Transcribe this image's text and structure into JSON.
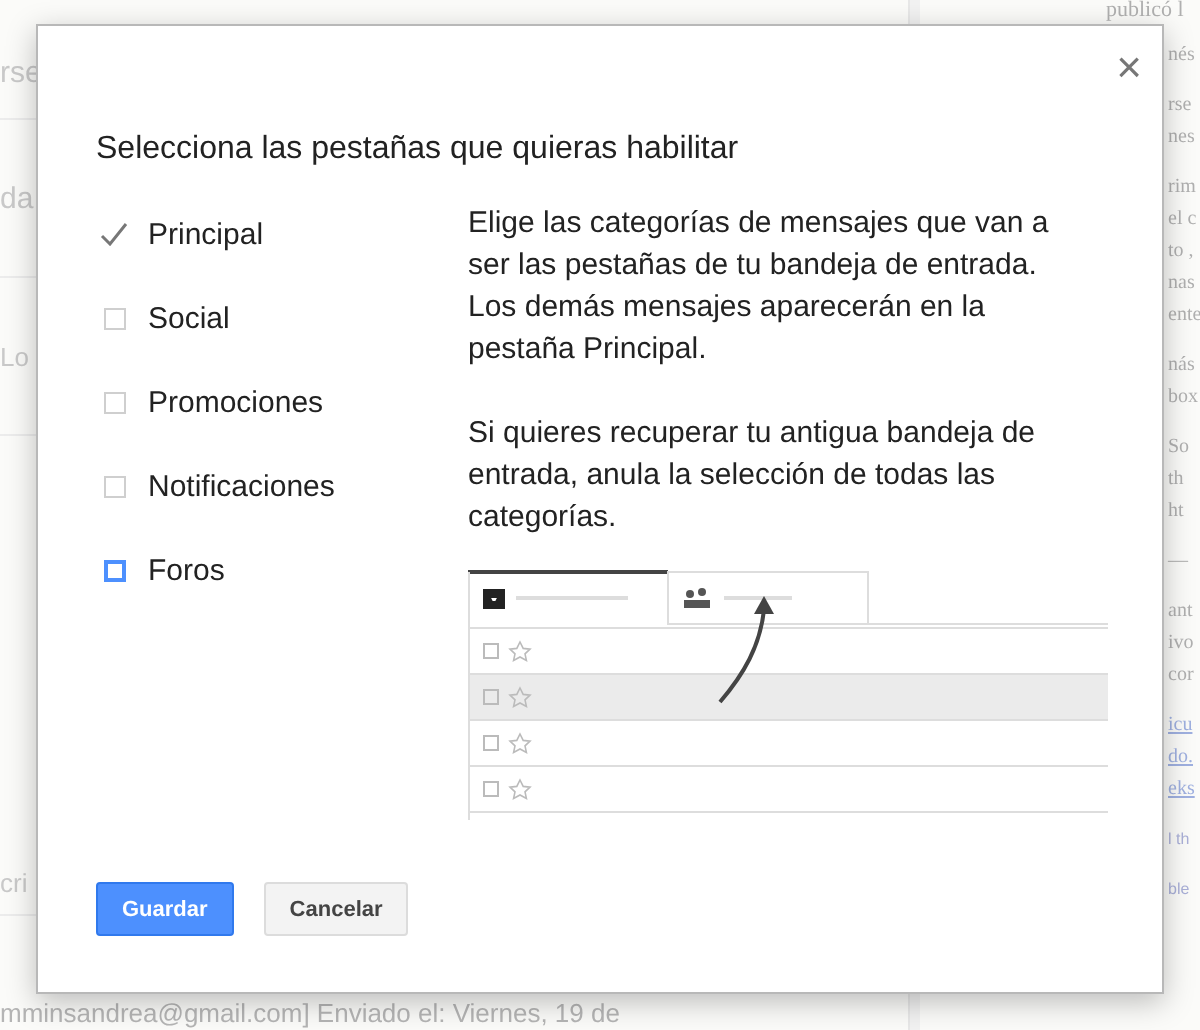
{
  "background": {
    "left_fragments": [
      "rse",
      "da",
      "Lo",
      "cri"
    ],
    "right_paragraphs": [
      {
        "lines": [
          "publicó l"
        ],
        "kind": "top"
      },
      {
        "lines": [
          "nés"
        ]
      },
      {
        "lines": [
          "rse",
          "nes"
        ]
      },
      {
        "lines": [
          "rim",
          "el c",
          "to ,",
          "nas",
          "ente"
        ]
      },
      {
        "lines": [
          "nás",
          "box"
        ]
      },
      {
        "lines": [
          "So",
          "th",
          "ht"
        ],
        "kind": "quote"
      },
      {
        "lines": [
          "—"
        ]
      },
      {
        "lines": [
          "ant",
          "ivo",
          "cor"
        ]
      },
      {
        "lines": [
          "icu",
          "do.",
          "eks"
        ],
        "kind": "links"
      },
      {
        "lines": [
          "l th"
        ],
        "kind": "small"
      },
      {
        "lines": [
          "ble"
        ],
        "kind": "small"
      }
    ],
    "bottom_line": "mminsandrea@gmail.com] Enviado el: Viernes, 19 de"
  },
  "dialog": {
    "title": "Selecciona las pestañas que quieras habilitar",
    "close": "×",
    "categories": [
      {
        "label": "Principal",
        "checked": true,
        "focused": false
      },
      {
        "label": "Social",
        "checked": false,
        "focused": false
      },
      {
        "label": "Promociones",
        "checked": false,
        "focused": false
      },
      {
        "label": "Notificaciones",
        "checked": false,
        "focused": false
      },
      {
        "label": "Foros",
        "checked": false,
        "focused": true
      }
    ],
    "paragraphs": [
      "Elige las categorías de mensajes que van a ser las pestañas de tu bandeja de entrada. Los demás mensajes aparecerán en la pestaña Principal.",
      "Si quieres recuperar tu antigua bandeja de entrada, anula la selección de todas las categorías."
    ],
    "buttons": [
      {
        "label": "Guardar",
        "kind": "primary"
      },
      {
        "label": "Cancelar",
        "kind": "secondary"
      }
    ]
  }
}
